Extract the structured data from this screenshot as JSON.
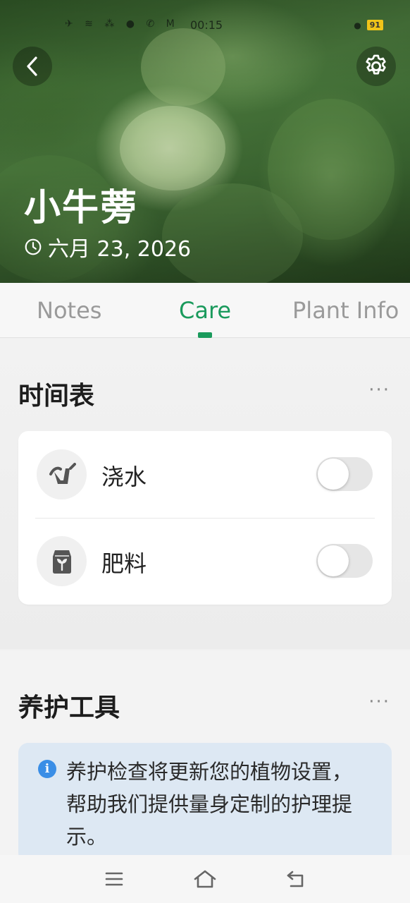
{
  "status_bar": {
    "time": "00:15",
    "battery": "91",
    "left_icons": "✈ ≋ ⁂ ● ✆ M"
  },
  "header": {
    "plant_name": "小牛蒡",
    "date": "六月 23, 2026"
  },
  "tabs": [
    {
      "label": "Notes",
      "active": false
    },
    {
      "label": "Care",
      "active": true
    },
    {
      "label": "Plant Info",
      "active": false
    }
  ],
  "schedule": {
    "title": "时间表",
    "more": "···",
    "items": [
      {
        "label": "浇水",
        "icon": "watering-can-icon",
        "enabled": false
      },
      {
        "label": "肥料",
        "icon": "fertilizer-bag-icon",
        "enabled": false
      }
    ]
  },
  "tools": {
    "title": "养护工具",
    "more": "···",
    "info_icon": "i",
    "info_text": "养护检查将更新您的植物设置，帮助我们提供量身定制的护理提示。"
  },
  "colors": {
    "accent": "#1a9a5c",
    "info_bg": "#dde8f3",
    "info_icon": "#3a8ee6"
  }
}
